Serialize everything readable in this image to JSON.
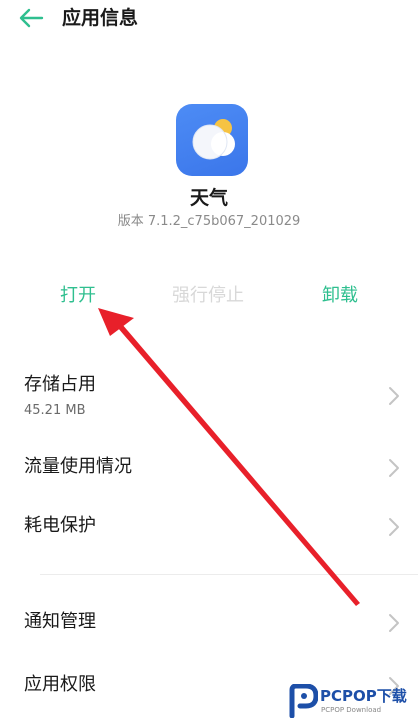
{
  "header": {
    "title": "应用信息"
  },
  "app": {
    "name": "天气",
    "version": "版本 7.1.2_c75b067_201029"
  },
  "actions": {
    "open": "打开",
    "force_stop": "强行停止",
    "uninstall": "卸载"
  },
  "list": {
    "storage_title": "存储占用",
    "storage_value": "45.21 MB",
    "data_usage": "流量使用情况",
    "battery": "耗电保护",
    "notifications": "通知管理",
    "permissions": "应用权限"
  },
  "watermark": {
    "brand": "PCPOP下载",
    "tagline": "PCPOP Download"
  },
  "colors": {
    "accent": "#2fbf8f",
    "disabled": "#d8d8d8",
    "app_icon_bg": "#3f7ff0",
    "annotation_arrow": "#e8202a"
  },
  "icons": {
    "back": "arrow-left-icon",
    "chevron": "chevron-right-icon",
    "app": "weather-cloud-sun-icon"
  }
}
